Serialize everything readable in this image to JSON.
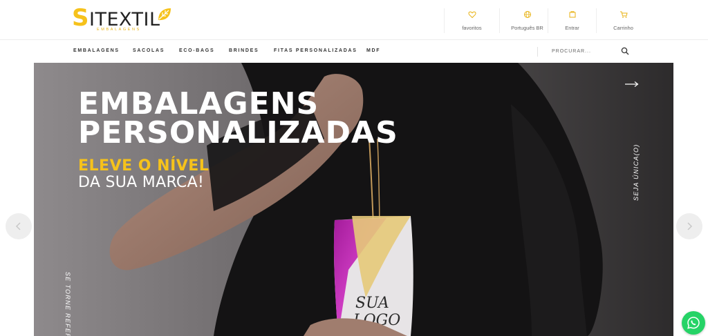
{
  "brand": {
    "logo_text": "ITEXTIL",
    "logo_initial": "S",
    "logo_subtext": "EMBALAGENS",
    "accent_color": "#f6c21b"
  },
  "header": {
    "items": [
      {
        "label": "favoritos",
        "icon": "heart-icon"
      },
      {
        "label": "Português BR",
        "icon": "globe-icon"
      },
      {
        "label": "Entrar",
        "icon": "user-icon"
      },
      {
        "label": "Carrinho",
        "icon": "cart-icon"
      }
    ]
  },
  "nav": {
    "items": [
      "EMBALAGENS",
      "SACOLAS",
      "ECO-BAGS",
      "BRINDES",
      "FITAS PERSONALIZADAS",
      "MDF"
    ],
    "search_placeholder": "PROCURAR..."
  },
  "hero": {
    "title_line1": "EMBALAGENS",
    "title_line2": "PERSONALIZADAS",
    "subtitle_line1": "ELEVE O NÍVEL",
    "subtitle_line2": "DA SUA MARCA!",
    "vertical_right": "SEJA ÚNICA(O)",
    "vertical_left": "SE TORNE REFERÊ",
    "bag_logo_line1": "SUA",
    "bag_logo_line2": "LOGO"
  },
  "icons": {
    "carousel_prev": "chevron-left-icon",
    "carousel_next": "chevron-right-icon",
    "hero_arrow": "arrow-right-icon",
    "whatsapp": "whatsapp-icon",
    "search": "search-icon"
  }
}
